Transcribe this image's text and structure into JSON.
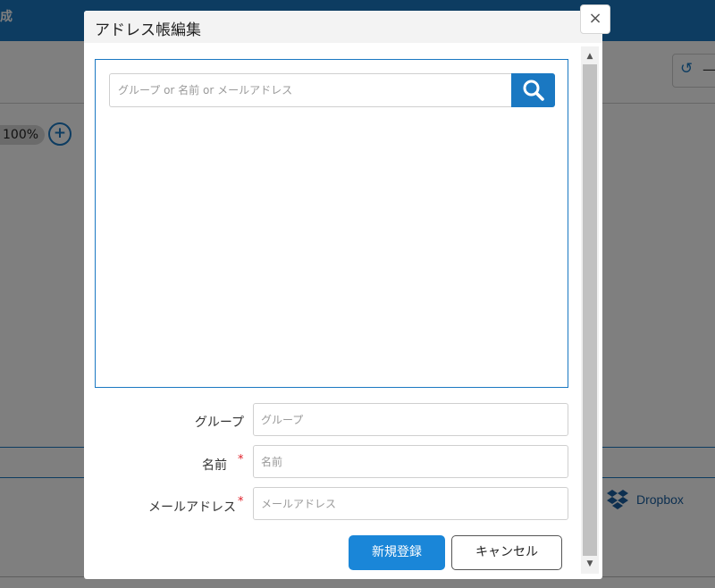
{
  "background": {
    "title_fragment": "成",
    "zoom_level": "100%",
    "zoom_in_symbol": "+",
    "undo_icon": "undo-icon",
    "dash_glyph": "—",
    "dropbox_label": "Dropbox"
  },
  "modal": {
    "title": "アドレス帳編集",
    "close_symbol": "×",
    "search": {
      "placeholder": "グループ or 名前 or メールアドレス",
      "button_icon": "search-icon"
    },
    "form": {
      "group": {
        "label": "グループ",
        "placeholder": "グループ",
        "required": false
      },
      "name": {
        "label": "名前",
        "placeholder": "名前",
        "required": true
      },
      "email": {
        "label": "メールアドレス",
        "placeholder": "メールアドレス",
        "required": true
      },
      "required_mark": "*"
    },
    "buttons": {
      "register": "新規登録",
      "cancel": "キャンセル"
    }
  },
  "colors": {
    "accent": "#1a78c2",
    "primary_button": "#1a86d8",
    "required_mark": "#e0202a"
  }
}
